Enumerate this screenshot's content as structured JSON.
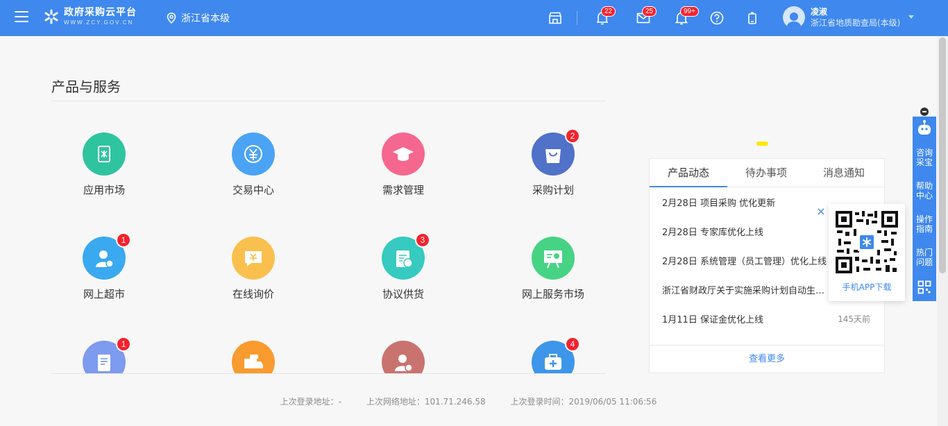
{
  "header": {
    "logo_title": "政府采购云平台",
    "logo_subtitle": "WWW.ZCY.GOV.CN",
    "region": "浙江省本级",
    "badges": {
      "notice": "22",
      "mail": "25",
      "bell": "99+"
    },
    "user": {
      "name": "凌淑",
      "org": "浙江省地质勘查局(本级)"
    }
  },
  "main": {
    "section_title": "产品与服务",
    "tiles": [
      {
        "label": "应用市场",
        "badge": "",
        "color": "#2fc4a0"
      },
      {
        "label": "交易中心",
        "badge": "",
        "color": "#4aa3f4"
      },
      {
        "label": "需求管理",
        "badge": "",
        "color": "#f5678f"
      },
      {
        "label": "采购计划",
        "badge": "2",
        "color": "#5072c8"
      },
      {
        "label": "网上超市",
        "badge": "1",
        "color": "#3aa9ef"
      },
      {
        "label": "在线询价",
        "badge": "",
        "color": "#f9c04e"
      },
      {
        "label": "协议供货",
        "badge": "3",
        "color": "#36cac0"
      },
      {
        "label": "网上服务市场",
        "badge": "",
        "color": "#47d384"
      },
      {
        "label": "",
        "badge": "1",
        "color": "#7d9bef"
      },
      {
        "label": "",
        "badge": "",
        "color": "#f99b2e"
      },
      {
        "label": "",
        "badge": "",
        "color": "#c9736f"
      },
      {
        "label": "",
        "badge": "4",
        "color": "#3d96ea"
      }
    ]
  },
  "news_panel": {
    "tabs": [
      "产品动态",
      "待办事项",
      "消息通知"
    ],
    "items": [
      {
        "title": "2月28日 项目采购 优化更新",
        "time": ""
      },
      {
        "title": "2月28日 专家库优化上线",
        "time": ""
      },
      {
        "title": "2月28日 系统管理（员工管理）优化上线",
        "time": ""
      },
      {
        "title": "浙江省财政厅关于实施采购计划自动生成功能",
        "time": ""
      },
      {
        "title": "1月11日 保证金优化上线",
        "time": "145天前"
      }
    ],
    "more": "查看更多"
  },
  "qr_popup": {
    "caption": "手机APP下载",
    "close": "×"
  },
  "side_bar": {
    "items": [
      "咨询采宝",
      "帮助中心",
      "操作指南",
      "热门问题"
    ]
  },
  "footer": {
    "last_login_address": "上次登录地址：-",
    "last_network_address": "上次网络地址：101.71.246.58",
    "last_login_time": "上次登录时间：2019/06/05 11:06:56"
  }
}
